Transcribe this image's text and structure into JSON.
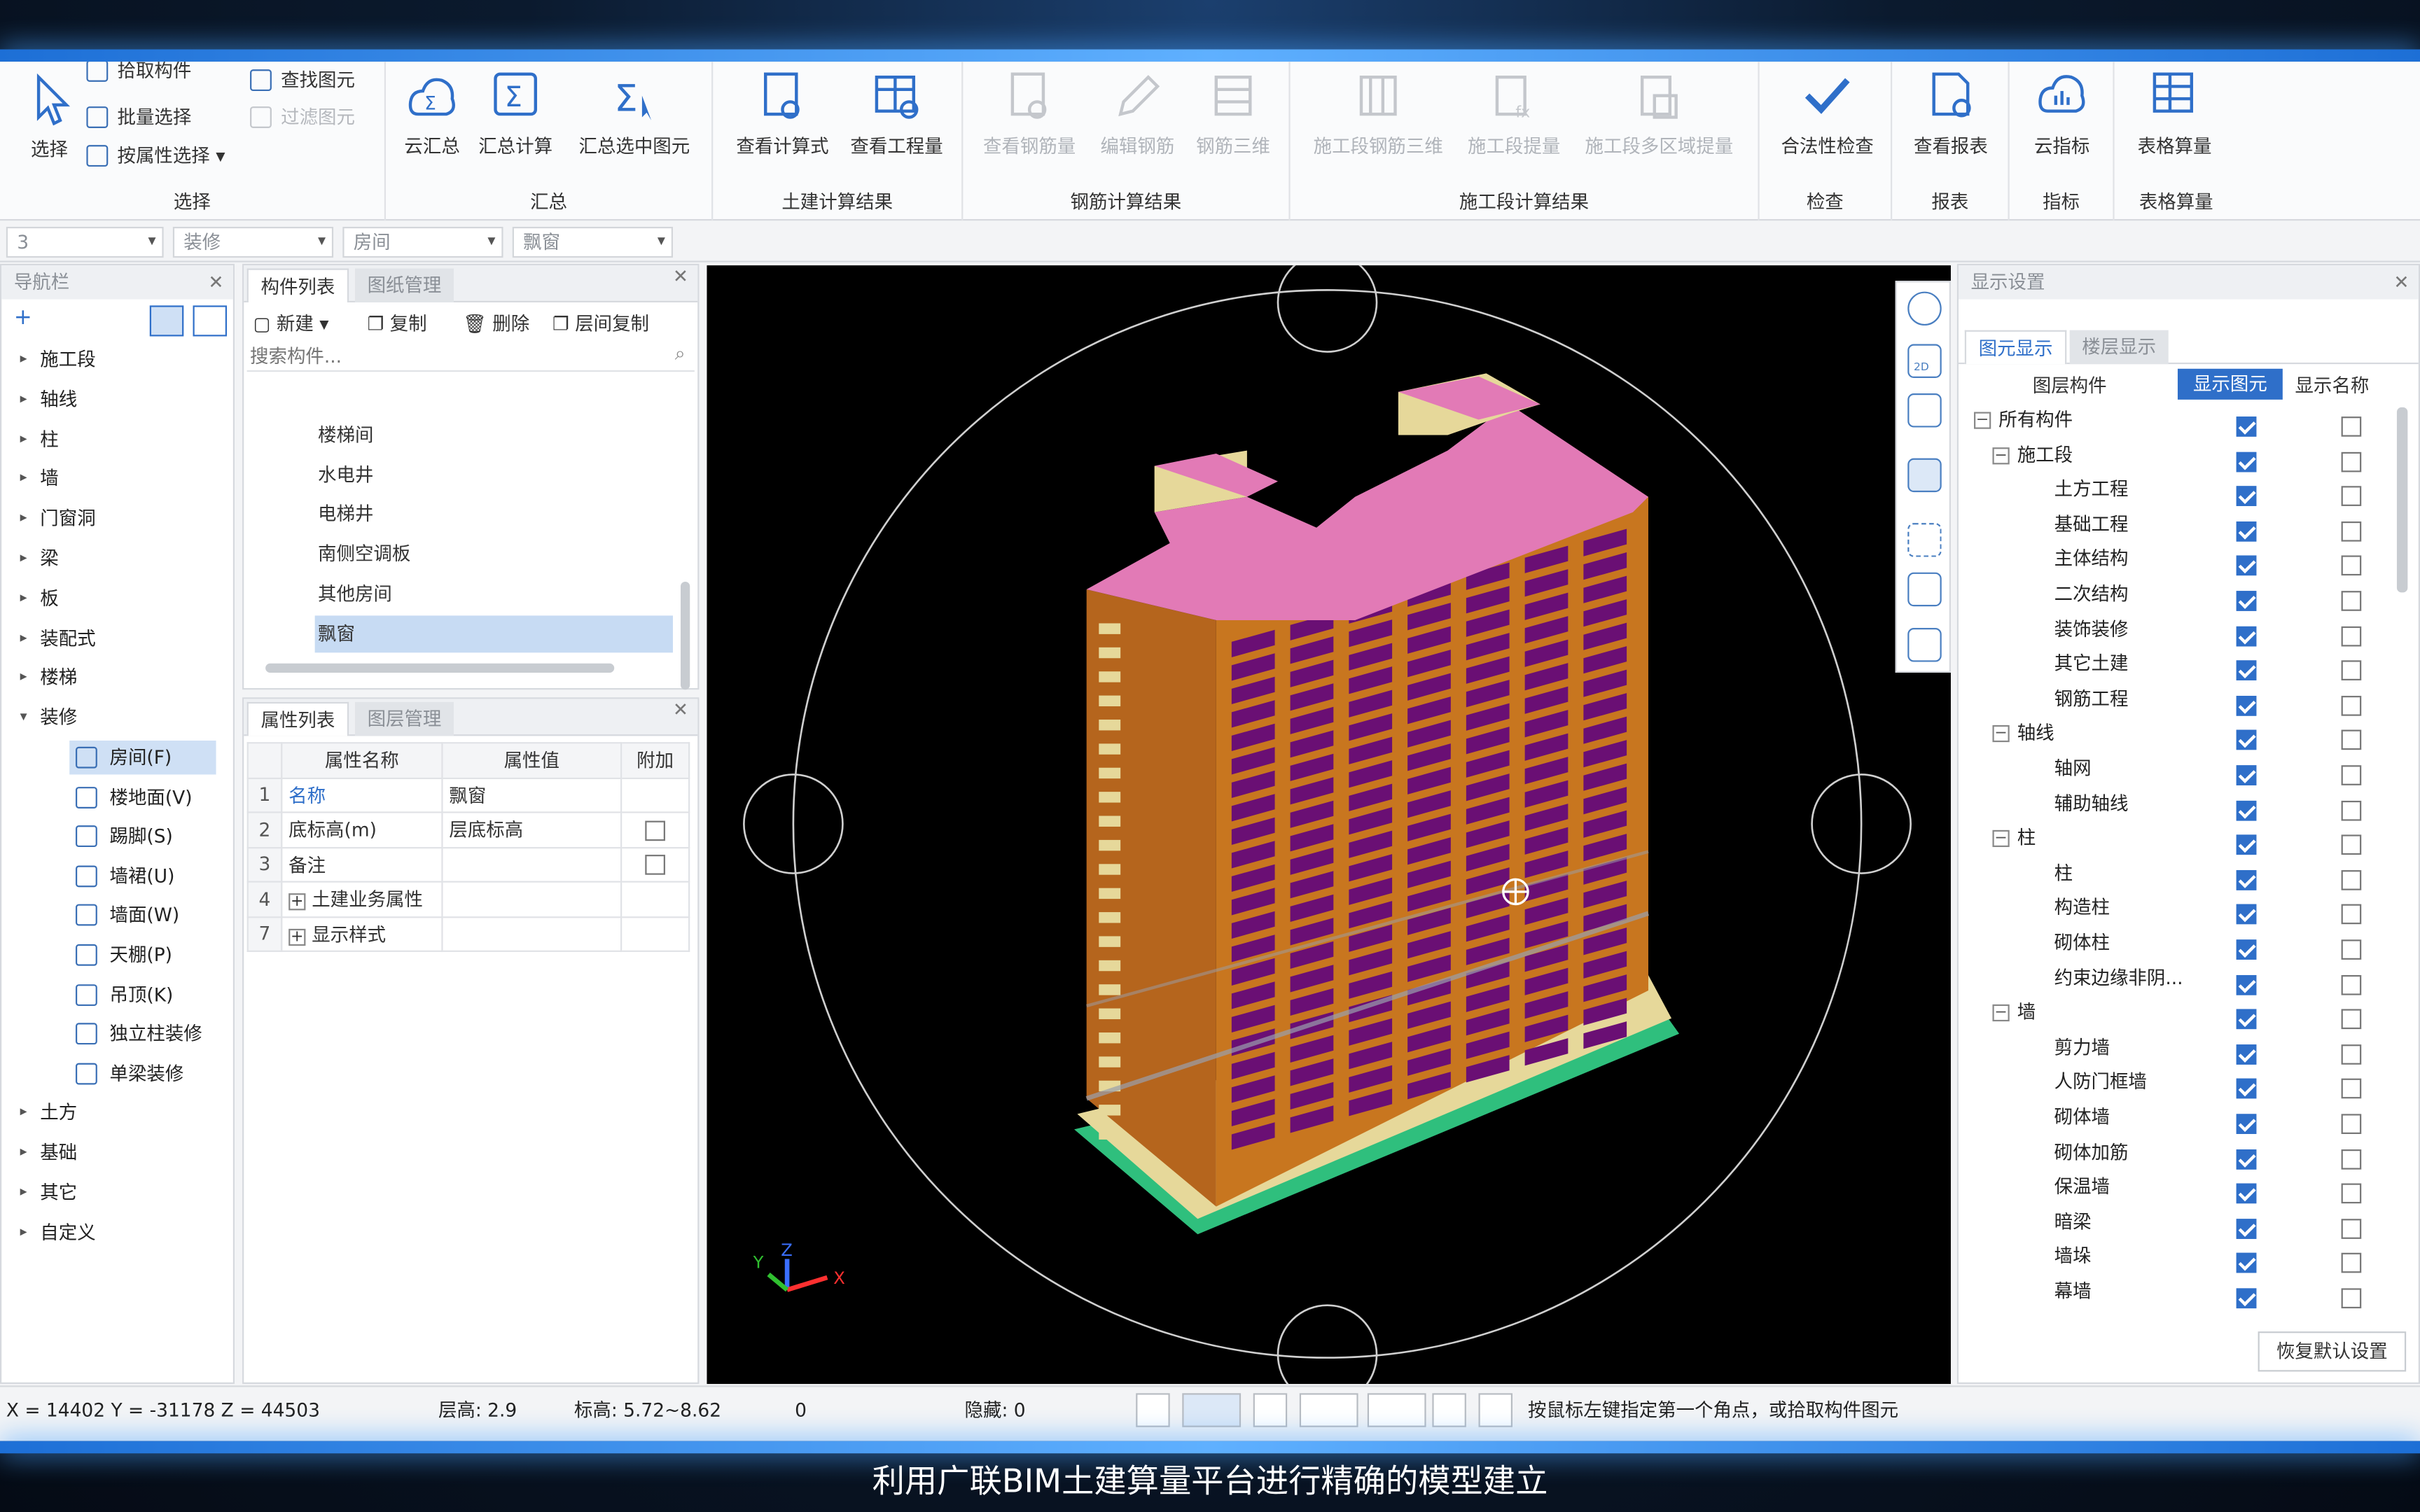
{
  "ribbon": {
    "select_group": {
      "title": "选择",
      "select_label": "选择",
      "pick_component": "拾取构件",
      "batch_select": "批量选择",
      "attr_select": "按属性选择",
      "find_element": "查找图元",
      "filter_element": "过滤图元"
    },
    "summary_group": {
      "title": "汇总",
      "cloud_summary": "云汇总",
      "summary_calc": "汇总计算",
      "summary_selected": "汇总选中图元"
    },
    "civil_group": {
      "title": "土建计算结果",
      "view_formula": "查看计算式",
      "view_quantity": "查看工程量"
    },
    "rebar_group": {
      "title": "钢筋计算结果",
      "view_rebar": "查看钢筋量",
      "edit_rebar": "编辑钢筋",
      "rebar_3d": "钢筋三维"
    },
    "stage_group": {
      "title": "施工段计算结果",
      "stage_rebar_3d": "施工段钢筋三维",
      "stage_extract": "施工段提量",
      "stage_multi": "施工段多区域提量"
    },
    "check_group": {
      "title": "检查",
      "legality_check": "合法性检查"
    },
    "report_group": {
      "title": "报表",
      "view_report": "查看报表"
    },
    "index_group": {
      "title": "指标",
      "cloud_index": "云指标"
    },
    "table_group": {
      "title": "表格算量",
      "table_calc": "表格算量"
    }
  },
  "filters": {
    "floor": "3",
    "category": "装修",
    "type": "房间",
    "component": "飘窗"
  },
  "nav": {
    "title": "导航栏",
    "items": [
      "施工段",
      "轴线",
      "柱",
      "墙",
      "门窗洞",
      "梁",
      "板",
      "装配式",
      "楼梯",
      "装修"
    ],
    "expanded": "装修",
    "sub_items": [
      "房间(F)",
      "楼地面(V)",
      "踢脚(S)",
      "墙裙(U)",
      "墙面(W)",
      "天棚(P)",
      "吊顶(K)",
      "独立柱装修",
      "单梁装修"
    ],
    "items_after": [
      "土方",
      "基础",
      "其它",
      "自定义"
    ]
  },
  "component_list": {
    "tab_active": "构件列表",
    "tab_other": "图纸管理",
    "new": "新建",
    "copy": "复制",
    "delete": "删除",
    "floor_copy": "层间复制",
    "search_placeholder": "搜索构件...",
    "items": [
      "楼梯间",
      "水电井",
      "电梯井",
      "南侧空调板",
      "其他房间",
      "飘窗"
    ],
    "selected": "飘窗"
  },
  "property_list": {
    "tab_active": "属性列表",
    "tab_other": "图层管理",
    "headers": [
      "属性名称",
      "属性值",
      "附加"
    ],
    "rows": [
      {
        "num": "1",
        "name": "名称",
        "value": "飘窗",
        "extra": ""
      },
      {
        "num": "2",
        "name": "底标高(m)",
        "value": "层底标高",
        "extra": "check"
      },
      {
        "num": "3",
        "name": "备注",
        "value": "",
        "extra": "check"
      },
      {
        "num": "4",
        "name": "土建业务属性",
        "value": "",
        "extra": ""
      },
      {
        "num": "7",
        "name": "显示样式",
        "value": "",
        "extra": ""
      }
    ]
  },
  "display_settings": {
    "title": "显示设置",
    "tab_active": "图元显示",
    "tab_other": "楼层显示",
    "headers": [
      "图层构件",
      "显示图元",
      "显示名称"
    ],
    "rows": [
      {
        "label": "所有构件",
        "level": 0,
        "box": "-",
        "show": true,
        "name": false
      },
      {
        "label": "施工段",
        "level": 1,
        "box": "-",
        "show": true,
        "name": false
      },
      {
        "label": "土方工程",
        "level": 2,
        "box": "",
        "show": true,
        "name": false
      },
      {
        "label": "基础工程",
        "level": 2,
        "box": "",
        "show": true,
        "name": false
      },
      {
        "label": "主体结构",
        "level": 2,
        "box": "",
        "show": true,
        "name": false
      },
      {
        "label": "二次结构",
        "level": 2,
        "box": "",
        "show": true,
        "name": false
      },
      {
        "label": "装饰装修",
        "level": 2,
        "box": "",
        "show": true,
        "name": false
      },
      {
        "label": "其它土建",
        "level": 2,
        "box": "",
        "show": true,
        "name": false
      },
      {
        "label": "钢筋工程",
        "level": 2,
        "box": "",
        "show": true,
        "name": false
      },
      {
        "label": "轴线",
        "level": 1,
        "box": "-",
        "show": true,
        "name": false
      },
      {
        "label": "轴网",
        "level": 2,
        "box": "",
        "show": true,
        "name": false
      },
      {
        "label": "辅助轴线",
        "level": 2,
        "box": "",
        "show": true,
        "name": false
      },
      {
        "label": "柱",
        "level": 1,
        "box": "-",
        "show": true,
        "name": false
      },
      {
        "label": "柱",
        "level": 2,
        "box": "",
        "show": true,
        "name": false
      },
      {
        "label": "构造柱",
        "level": 2,
        "box": "",
        "show": true,
        "name": false
      },
      {
        "label": "砌体柱",
        "level": 2,
        "box": "",
        "show": true,
        "name": false
      },
      {
        "label": "约束边缘非阴...",
        "level": 2,
        "box": "",
        "show": true,
        "name": false
      },
      {
        "label": "墙",
        "level": 1,
        "box": "-",
        "show": true,
        "name": false
      },
      {
        "label": "剪力墙",
        "level": 2,
        "box": "",
        "show": true,
        "name": false
      },
      {
        "label": "人防门框墙",
        "level": 2,
        "box": "",
        "show": true,
        "name": false
      },
      {
        "label": "砌体墙",
        "level": 2,
        "box": "",
        "show": true,
        "name": false
      },
      {
        "label": "砌体加筋",
        "level": 2,
        "box": "",
        "show": true,
        "name": false
      },
      {
        "label": "保温墙",
        "level": 2,
        "box": "",
        "show": true,
        "name": false
      },
      {
        "label": "暗梁",
        "level": 2,
        "box": "",
        "show": true,
        "name": false
      },
      {
        "label": "墙垛",
        "level": 2,
        "box": "",
        "show": true,
        "name": false
      },
      {
        "label": "幕墙",
        "level": 2,
        "box": "",
        "show": true,
        "name": false
      }
    ],
    "restore_button": "恢复默认设置"
  },
  "status": {
    "coords": "X = 14402 Y = -31178 Z = 44503",
    "floor_height": "层高:  2.9",
    "elevation": "标高:  5.72~8.62",
    "zero": "0",
    "hidden": "隐藏:  0",
    "hint": "按鼠标左键指定第一个角点，或拾取构件图元"
  },
  "subtitle": "利用广联BIM土建算量平台进行精确的模型建立",
  "colors": {
    "accent": "#2f6fc9",
    "roof": "#e27ab6",
    "facade": "#c8761f",
    "windows": "#6a0f74",
    "trim": "#eadb93"
  }
}
